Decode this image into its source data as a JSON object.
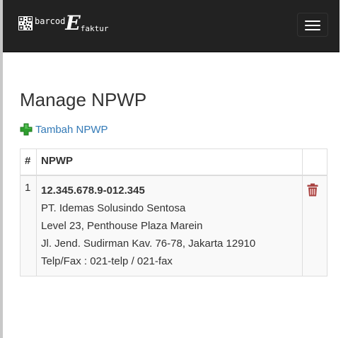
{
  "navbar": {
    "brand_prefix": "barcod",
    "brand_e": "E",
    "brand_suffix": "faktur"
  },
  "page": {
    "title": "Manage NPWP"
  },
  "actions": {
    "add_label": "Tambah NPWP"
  },
  "table": {
    "headers": {
      "num": "#",
      "npwp": "NPWP",
      "action": ""
    },
    "rows": [
      {
        "num": "1",
        "npwp": "12.345.678.9-012.345",
        "name": "PT. Idemas Solusindo Sentosa",
        "address1": "Level 23, Penthouse Plaza Marein",
        "address2": "Jl. Jend. Sudirman Kav. 76-78, Jakarta 12910",
        "contact": "Telp/Fax : 021-telp / 021-fax"
      }
    ]
  },
  "colors": {
    "navbar_bg": "#222222",
    "link": "#337ab7",
    "add_icon": "#2e9e2e",
    "delete_icon": "#a94442"
  },
  "icons": [
    "qr-code-icon",
    "menu-icon",
    "plus-icon",
    "trash-icon"
  ]
}
